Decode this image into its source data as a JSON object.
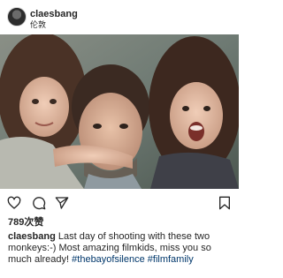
{
  "post": {
    "username": "claesbang",
    "location": "伦敦",
    "likes_count": "789",
    "likes_suffix": "次赞",
    "caption_user": "claesbang",
    "caption_text": " Last day of shooting with these two monkeys:-) Most amazing filmkids, miss you so much already! ",
    "hashtags": [
      "#thebayofsilence",
      "#filmfamily"
    ]
  },
  "actions": {
    "like_icon": "heart-icon",
    "comment_icon": "comment-icon",
    "share_icon": "share-icon",
    "save_icon": "bookmark-icon"
  },
  "colors": {
    "text": "#262626",
    "link": "#00376b",
    "photo_bg": "#6e7a73"
  }
}
